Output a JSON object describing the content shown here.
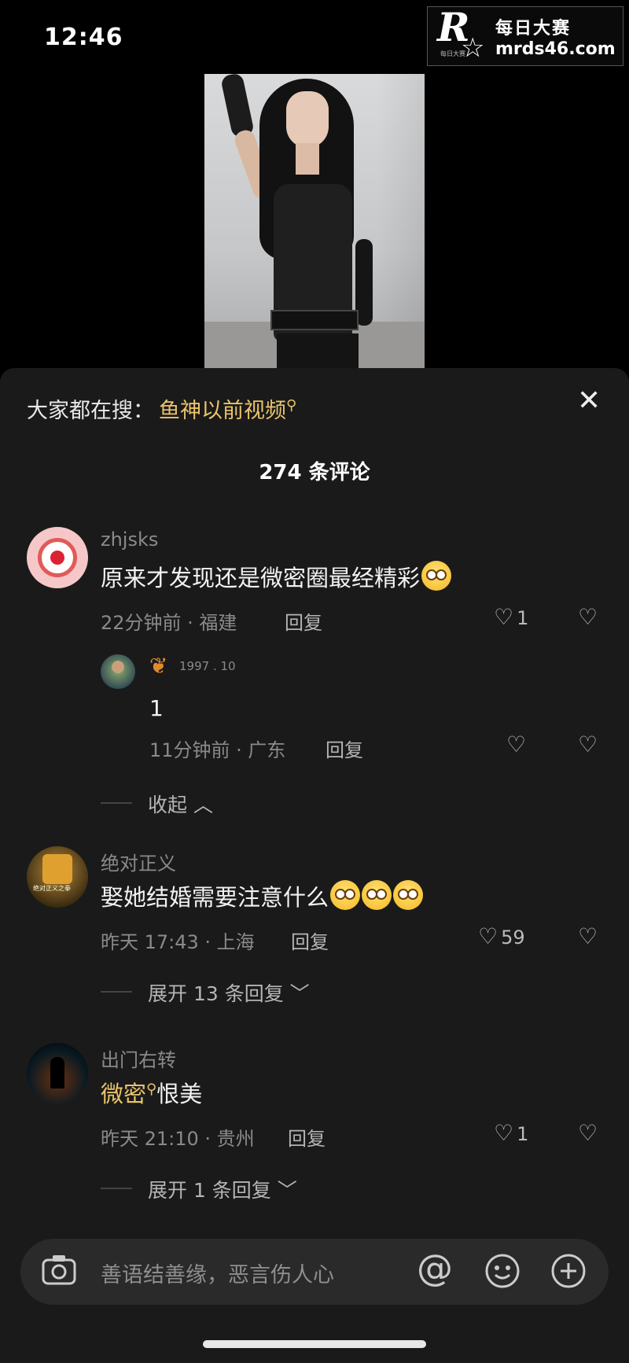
{
  "status_bar": {
    "time": "12:46"
  },
  "watermark": {
    "logo_letter": "R",
    "logo_sub": "每日大赛",
    "title": "每日大赛",
    "url": "mrds46.com"
  },
  "panel": {
    "search_prefix": "大家都在搜：",
    "search_keyword": "鱼神以前视频",
    "close_label": "✕",
    "comment_count": "274 条评论"
  },
  "comments": [
    {
      "username": "zhjsks",
      "text": "原来才发现还是微密圈最经精彩",
      "time_location": "22分钟前 · 福建",
      "reply_label": "回复",
      "likes": "1",
      "replies": [
        {
          "username": "1997 . 10",
          "text": "1",
          "time_location": "11分钟前 · 广东",
          "reply_label": "回复"
        }
      ],
      "fold_label": "收起"
    },
    {
      "username": "绝对正义",
      "avatar_text": "绝对正义之拳",
      "text": "娶她结婚需要注意什么",
      "time_location": "昨天 17:43 · 上海",
      "reply_label": "回复",
      "likes": "59",
      "expand_label": "展开 13 条回复"
    },
    {
      "username": "出门右转",
      "text_keyword": "微密",
      "text": "恨美",
      "time_location": "昨天 21:10 · 贵州",
      "reply_label": "回复",
      "likes": "1",
      "expand_label": "展开 1 条回复"
    }
  ],
  "input_bar": {
    "placeholder": "善语结善缘，恶言伤人心",
    "icons": [
      "camera-icon",
      "at-icon",
      "emoji-icon",
      "plus-icon"
    ]
  },
  "colors": {
    "background": "#000000",
    "panel": "#1a1a1a",
    "keyword": "#e9c46a",
    "muted": "#8a8a8a"
  }
}
